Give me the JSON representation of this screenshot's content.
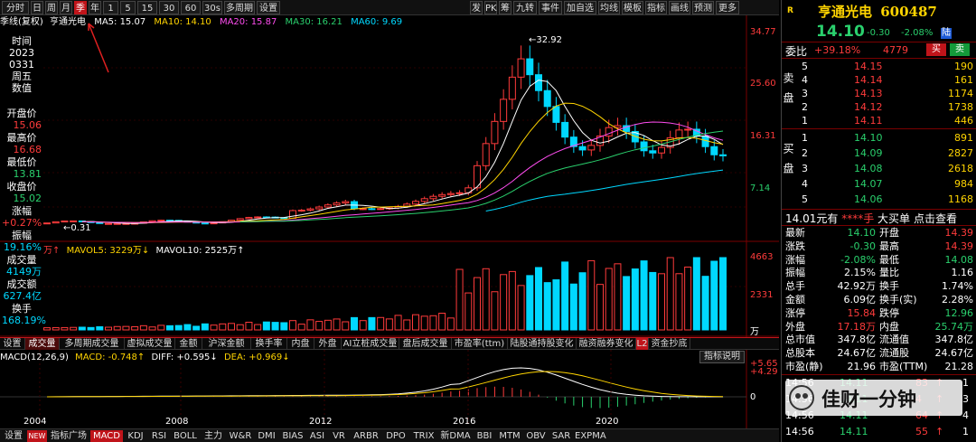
{
  "toolbar": {
    "periods": [
      "分时",
      "日",
      "周",
      "月",
      "季",
      "年",
      "1分",
      "5分",
      "15分",
      "30分",
      "60分",
      "30s",
      "多周期",
      "设置"
    ],
    "active_period": "季",
    "right": [
      "发",
      "PK",
      "筹",
      "九转",
      "事件",
      "加自选",
      "均线",
      "模板",
      "指标",
      "画线",
      "预测",
      "更多"
    ]
  },
  "legend": {
    "type": "季线(复权)",
    "name": "亨通光电",
    "ma5": "MA5: 15.07",
    "ma10": "MA10: 14.10",
    "ma20": "MA20: 15.87",
    "ma30": "MA30: 16.21",
    "ma60": "MA60: 9.69"
  },
  "left_info": {
    "time_label": "时间",
    "time_year": "2023",
    "time_date": "0331",
    "weekday": "周五",
    "value_label": "数值",
    "open_label": "开盘价",
    "open": "15.06",
    "high_label": "最高价",
    "high": "16.68",
    "low_label": "最低价",
    "low": "13.81",
    "close_label": "收盘价",
    "close": "15.02",
    "chg_label": "涨幅",
    "chg": "+0.27%",
    "amp_label": "振幅",
    "amp": "19.16%",
    "vol_label": "成交量",
    "vol": "4149万",
    "amt_label": "成交额",
    "amt": "627.4亿",
    "turn_label": "换手",
    "turn": "168.19%"
  },
  "price_axis": [
    "34.77",
    "25.60",
    "16.31",
    "7.14"
  ],
  "peak_label": "32.92",
  "low_label": "0.31",
  "vol_legend": {
    "unit": "万↑",
    "mavol5": "MAVOL5: 3229万↓",
    "mavol10": "MAVOL10: 2525万↑"
  },
  "vol_axis": [
    "4663",
    "2331",
    "万"
  ],
  "midtabs": [
    "设置",
    "成交量",
    "多周期成交量",
    "虚拟成交量",
    "金额",
    "沪深金额",
    "换手率",
    "内盘",
    "外盘",
    "AI立桩成交量",
    "盘后成交量",
    "市盈率(ttm)",
    "陆股通持股变化",
    "融资融券变化",
    "L2",
    "资金抄底"
  ],
  "midtab_right": "指标说明",
  "macd_legend": {
    "name": "MACD(12,26,9)",
    "macd": "MACD: -0.748↑",
    "diff": "DIFF: +0.595↓",
    "dea": "DEA: +0.969↓"
  },
  "macd_axis": [
    "5.65",
    "4.29",
    "0"
  ],
  "years": [
    "2004",
    "2008",
    "2012",
    "2016",
    "2020"
  ],
  "bottom_tabs": [
    "设置",
    "NEW",
    "指标广场",
    "MACD",
    "KDJ",
    "RSI",
    "BOLL",
    "主力",
    "W&R",
    "DMI",
    "BIAS",
    "ASI",
    "VR",
    "ARBR",
    "DPO",
    "TRIX",
    "新DMA",
    "BBI",
    "MTM",
    "OBV",
    "SAR",
    "EXPMA"
  ],
  "quote": {
    "r_badge": "R",
    "name": "亨通光电",
    "code": "600487",
    "price": "14.10",
    "change": "-0.30",
    "pct": "-2.08%",
    "lu": "陆",
    "webi_label": "委比",
    "webi": "+39.18%",
    "wecha": "4779",
    "buy_btn": "买",
    "sell_btn": "卖",
    "sell_label": "卖盘",
    "buy_label": "买盘",
    "asks": [
      {
        "lvl": "5",
        "price": "14.15",
        "vol": "190"
      },
      {
        "lvl": "4",
        "price": "14.14",
        "vol": "161"
      },
      {
        "lvl": "3",
        "price": "14.13",
        "vol": "1174"
      },
      {
        "lvl": "2",
        "price": "14.12",
        "vol": "1738"
      },
      {
        "lvl": "1",
        "price": "14.11",
        "vol": "446"
      }
    ],
    "bids": [
      {
        "lvl": "1",
        "price": "14.10",
        "vol": "891"
      },
      {
        "lvl": "2",
        "price": "14.09",
        "vol": "2827"
      },
      {
        "lvl": "3",
        "price": "14.08",
        "vol": "2618"
      },
      {
        "lvl": "4",
        "price": "14.07",
        "vol": "984"
      },
      {
        "lvl": "5",
        "price": "14.06",
        "vol": "1168"
      }
    ],
    "big_order": {
      "price": "14.01元有",
      "hand": "****手",
      "label": "大买单",
      "link": "点击查看"
    },
    "stats": [
      {
        "k1": "最新",
        "v1": "14.10",
        "k2": "开盘",
        "v2": "14.39"
      },
      {
        "k1": "涨跌",
        "v1": "-0.30",
        "k2": "最高",
        "v2": "14.39"
      },
      {
        "k1": "涨幅",
        "v1": "-2.08%",
        "k2": "最低",
        "v2": "14.08"
      },
      {
        "k1": "振幅",
        "v1": "2.15%",
        "k2": "量比",
        "v2": "1.16"
      },
      {
        "k1": "总手",
        "v1": "42.92万",
        "k2": "换手",
        "v2": "1.74%"
      },
      {
        "k1": "金额",
        "v1": "6.09亿",
        "k2": "换手(实)",
        "v2": "2.28%"
      },
      {
        "k1": "涨停",
        "v1": "15.84",
        "k2": "跌停",
        "v2": "12.96"
      },
      {
        "k1": "外盘",
        "v1": "17.18万",
        "k2": "内盘",
        "v2": "25.74万"
      },
      {
        "k1": "总市值",
        "v1": "347.8亿",
        "k2": "流通值",
        "v2": "347.8亿"
      },
      {
        "k1": "总股本",
        "v1": "24.67亿",
        "k2": "流通股",
        "v2": "24.67亿"
      },
      {
        "k1": "市盈(静)",
        "v1": "21.96",
        "k2": "市盈(TTM)",
        "v2": "21.28"
      }
    ],
    "ticks": [
      {
        "time": "14:56",
        "price": "14.11",
        "vol": "83",
        "arrow": "↑",
        "num": "1"
      },
      {
        "time": "14:56",
        "price": "14.11",
        "vol": "4",
        "arrow": "↑",
        "num": "3"
      },
      {
        "time": "14:56",
        "price": "14.11",
        "vol": "64",
        "arrow": "↑",
        "num": "4"
      },
      {
        "time": "14:56",
        "price": "14.11",
        "vol": "55",
        "arrow": "↑",
        "num": "1"
      }
    ]
  },
  "watermark": "佳财一分钟",
  "colors": {
    "up": "#ff3b3b",
    "down": "#2ad06d",
    "cyan": "#00d8ff",
    "accent": "#c0141a"
  }
}
